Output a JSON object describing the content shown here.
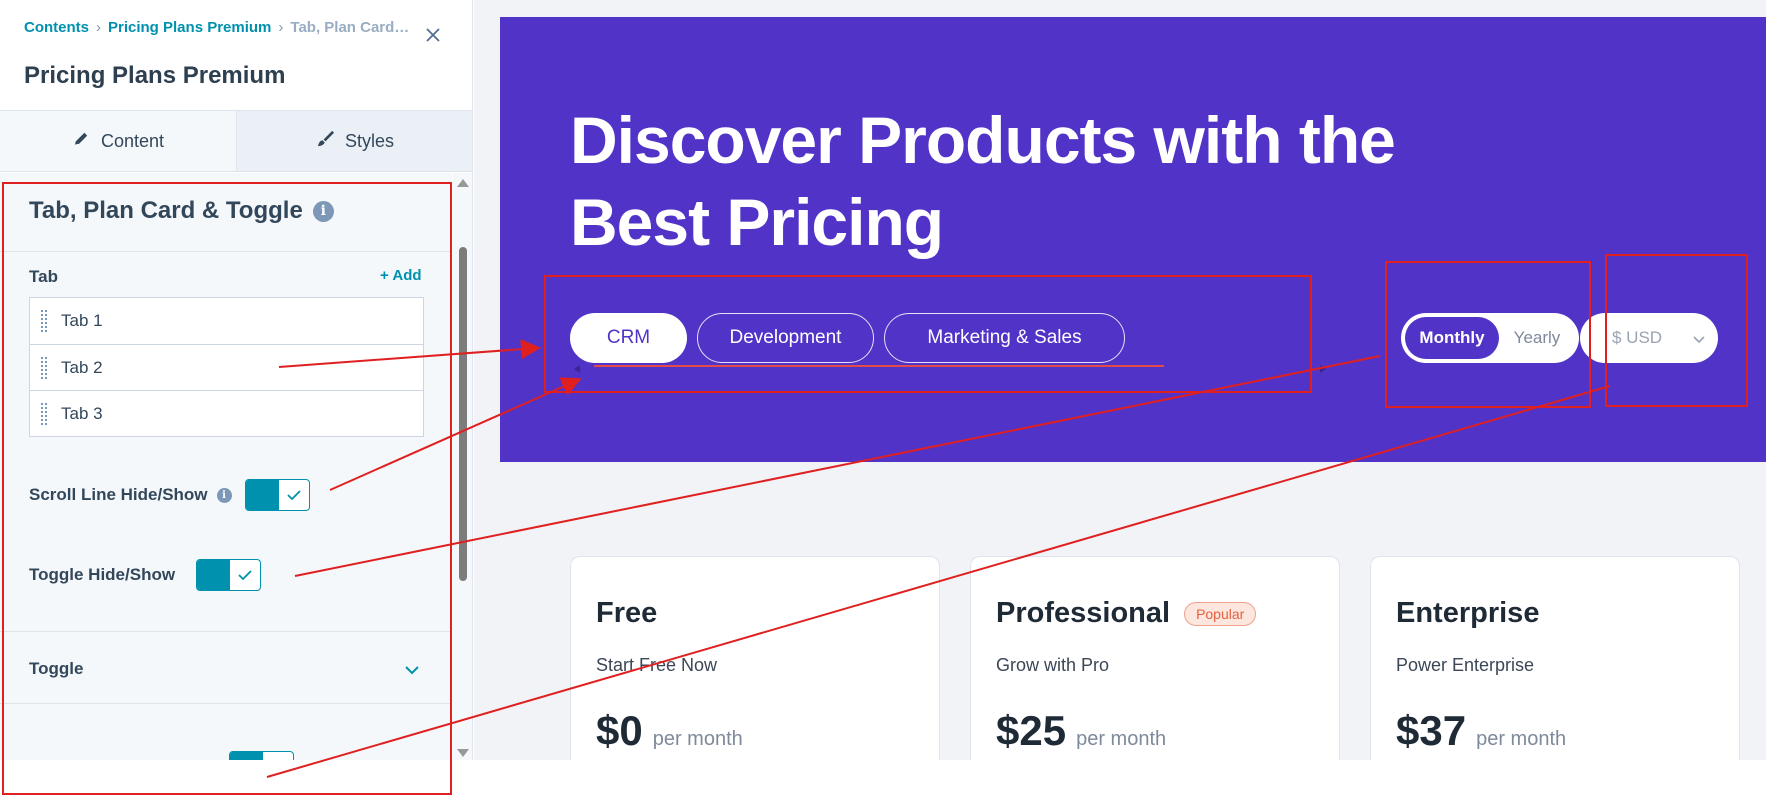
{
  "editor": {
    "breadcrumbs": [
      "Contents",
      "Pricing Plans Premium",
      "Tab, Plan Card…"
    ],
    "title": "Pricing Plans Premium",
    "tabs": {
      "content": "Content",
      "styles": "Styles"
    },
    "section_title": "Tab, Plan Card & Toggle",
    "tab_field_label": "Tab",
    "add_label": "+ Add",
    "tab_items": [
      "Tab 1",
      "Tab 2",
      "Tab 3"
    ],
    "scroll_line_label": "Scroll Line Hide/Show",
    "toggle_label": "Toggle Hide/Show",
    "accordion_label": "Toggle"
  },
  "preview": {
    "hero_title": "Discover Products with the Best Pricing",
    "category_tabs": [
      "CRM",
      "Development",
      "Marketing & Sales"
    ],
    "active_tab": "CRM",
    "billing": {
      "monthly": "Monthly",
      "yearly": "Yearly",
      "selected": "Monthly"
    },
    "currency": "$ USD",
    "plans": [
      {
        "name": "Free",
        "badge": "",
        "subtitle": "Start Free Now",
        "price": "$0",
        "period": "per month"
      },
      {
        "name": "Professional",
        "badge": "Popular",
        "subtitle": "Grow with Pro",
        "price": "$25",
        "period": "per month"
      },
      {
        "name": "Enterprise",
        "badge": "",
        "subtitle": "Power Enterprise",
        "price": "$37",
        "period": "per month"
      }
    ]
  },
  "colors": {
    "hero_bg": "#5133c8",
    "accent_teal": "#0091ae",
    "annotation_red": "#e02020",
    "badge_text": "#e5603f"
  },
  "icons": [
    "close-icon",
    "pencil-icon",
    "brush-icon",
    "info-icon",
    "drag-handle-icon",
    "check-icon",
    "chevron-down-icon"
  ]
}
